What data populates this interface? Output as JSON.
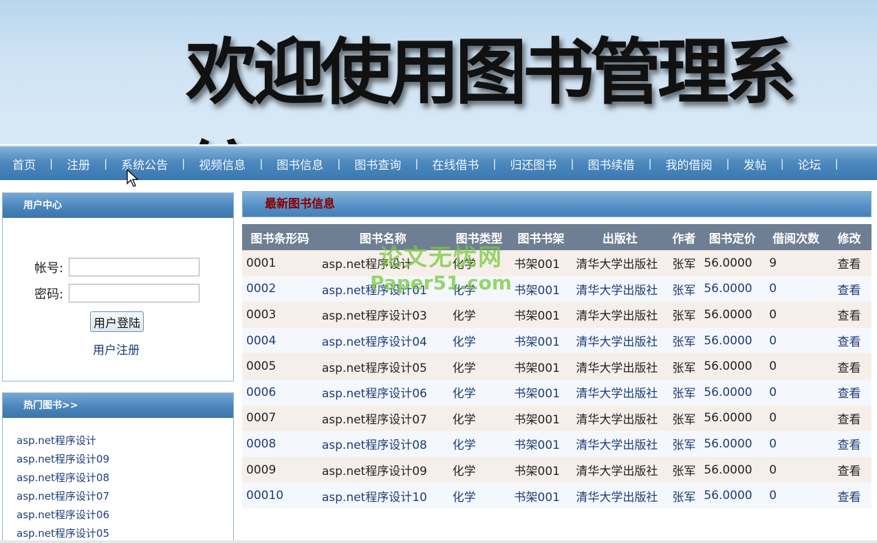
{
  "banner": {
    "title": "欢迎使用图书管理系统"
  },
  "nav": {
    "items": [
      {
        "label": "首页"
      },
      {
        "label": "注册"
      },
      {
        "label": "系统公告"
      },
      {
        "label": "视频信息"
      },
      {
        "label": "图书信息"
      },
      {
        "label": "图书查询"
      },
      {
        "label": "在线借书"
      },
      {
        "label": "归还图书"
      },
      {
        "label": "图书续借"
      },
      {
        "label": "我的借阅"
      },
      {
        "label": "发帖"
      },
      {
        "label": "论坛"
      }
    ],
    "separator": "|"
  },
  "user_center": {
    "title": "用户中心",
    "account_label": "帐号:",
    "password_label": "密码:",
    "login_button": "用户登陆",
    "register_link": "用户注册"
  },
  "hot_books": {
    "title": "热门图书>>",
    "items": [
      "asp.net程序设计",
      "asp.net程序设计09",
      "asp.net程序设计08",
      "asp.net程序设计07",
      "asp.net程序设计06",
      "asp.net程序设计05"
    ]
  },
  "main": {
    "title": "最新图书信息",
    "columns": [
      "图书条形码",
      "图书名称",
      "图书类型",
      "图书书架",
      "出版社",
      "作者",
      "图书定价",
      "借阅次数",
      "修改"
    ],
    "rows": [
      [
        "0001",
        "asp.net程序设计",
        "化学",
        "书架001",
        "清华大学出版社",
        "张军",
        "56.0000",
        "9",
        "查看"
      ],
      [
        "0002",
        "asp.net程序设计01",
        "化学",
        "书架001",
        "清华大学出版社",
        "张军",
        "56.0000",
        "0",
        "查看"
      ],
      [
        "0003",
        "asp.net程序设计03",
        "化学",
        "书架001",
        "清华大学出版社",
        "张军",
        "56.0000",
        "0",
        "查看"
      ],
      [
        "0004",
        "asp.net程序设计04",
        "化学",
        "书架001",
        "清华大学出版社",
        "张军",
        "56.0000",
        "0",
        "查看"
      ],
      [
        "0005",
        "asp.net程序设计05",
        "化学",
        "书架001",
        "清华大学出版社",
        "张军",
        "56.0000",
        "0",
        "查看"
      ],
      [
        "0006",
        "asp.net程序设计06",
        "化学",
        "书架001",
        "清华大学出版社",
        "张军",
        "56.0000",
        "0",
        "查看"
      ],
      [
        "0007",
        "asp.net程序设计07",
        "化学",
        "书架001",
        "清华大学出版社",
        "张军",
        "56.0000",
        "0",
        "查看"
      ],
      [
        "0008",
        "asp.net程序设计08",
        "化学",
        "书架001",
        "清华大学出版社",
        "张军",
        "56.0000",
        "0",
        "查看"
      ],
      [
        "0009",
        "asp.net程序设计09",
        "化学",
        "书架001",
        "清华大学出版社",
        "张军",
        "56.0000",
        "0",
        "查看"
      ],
      [
        "00010",
        "asp.net程序设计10",
        "化学",
        "书架001",
        "清华大学出版社",
        "张军",
        "56.0000",
        "0",
        "查看"
      ]
    ]
  },
  "watermark": {
    "line1": "论文无忧网",
    "line2": "Paper51.com"
  },
  "colors": {
    "nav_bg": "#4d89bf",
    "table_header_bg": "#6f7f93",
    "main_title": "#8b0000",
    "link": "#1d3c7a"
  }
}
